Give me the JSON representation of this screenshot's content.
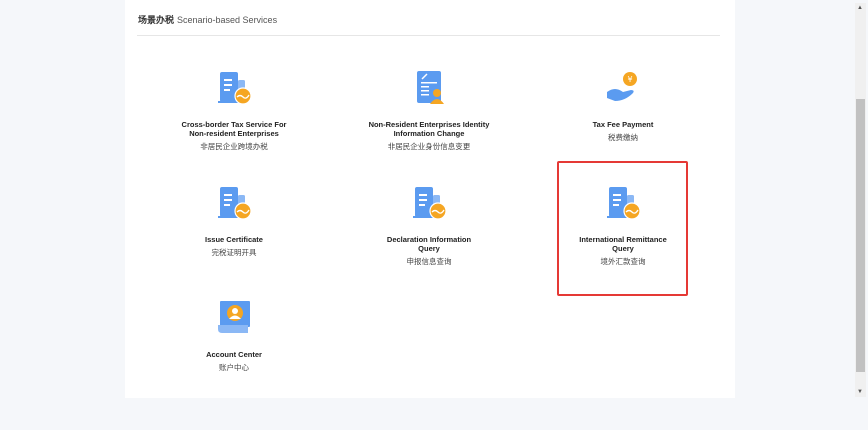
{
  "header": {
    "title_cn": "场景办税",
    "title_en": "Scenario-based Services"
  },
  "services": [
    {
      "title_line1": "Cross-border Tax Service For",
      "title_line2": "Non-resident Enterprises",
      "cn": "非居民企业跨境办税",
      "icon": "building-globe-icon"
    },
    {
      "title_line1": "Non-Resident Enterprises Identity",
      "title_line2": "Information Change",
      "cn": "非居民企业身份信息变更",
      "icon": "document-person-icon"
    },
    {
      "title_line1": "Tax Fee Payment",
      "title_line2": "",
      "cn": "税费缴纳",
      "icon": "hand-yuan-icon"
    },
    {
      "title_line1": "Issue Certificate",
      "title_line2": "",
      "cn": "完税证明开具",
      "icon": "building-globe-icon"
    },
    {
      "title_line1": "Declaration Information",
      "title_line2": "Query",
      "cn": "申报信息查询",
      "icon": "building-globe-icon"
    },
    {
      "title_line1": "International Remittance",
      "title_line2": "Query",
      "cn": "境外汇款查询",
      "icon": "building-globe-icon",
      "selected": true
    },
    {
      "title_line1": "Account Center",
      "title_line2": "",
      "cn": "账户中心",
      "icon": "account-book-icon"
    }
  ],
  "colors": {
    "blue": "#5b9bf0",
    "orange": "#f5a623",
    "highlight": "#e53935"
  }
}
